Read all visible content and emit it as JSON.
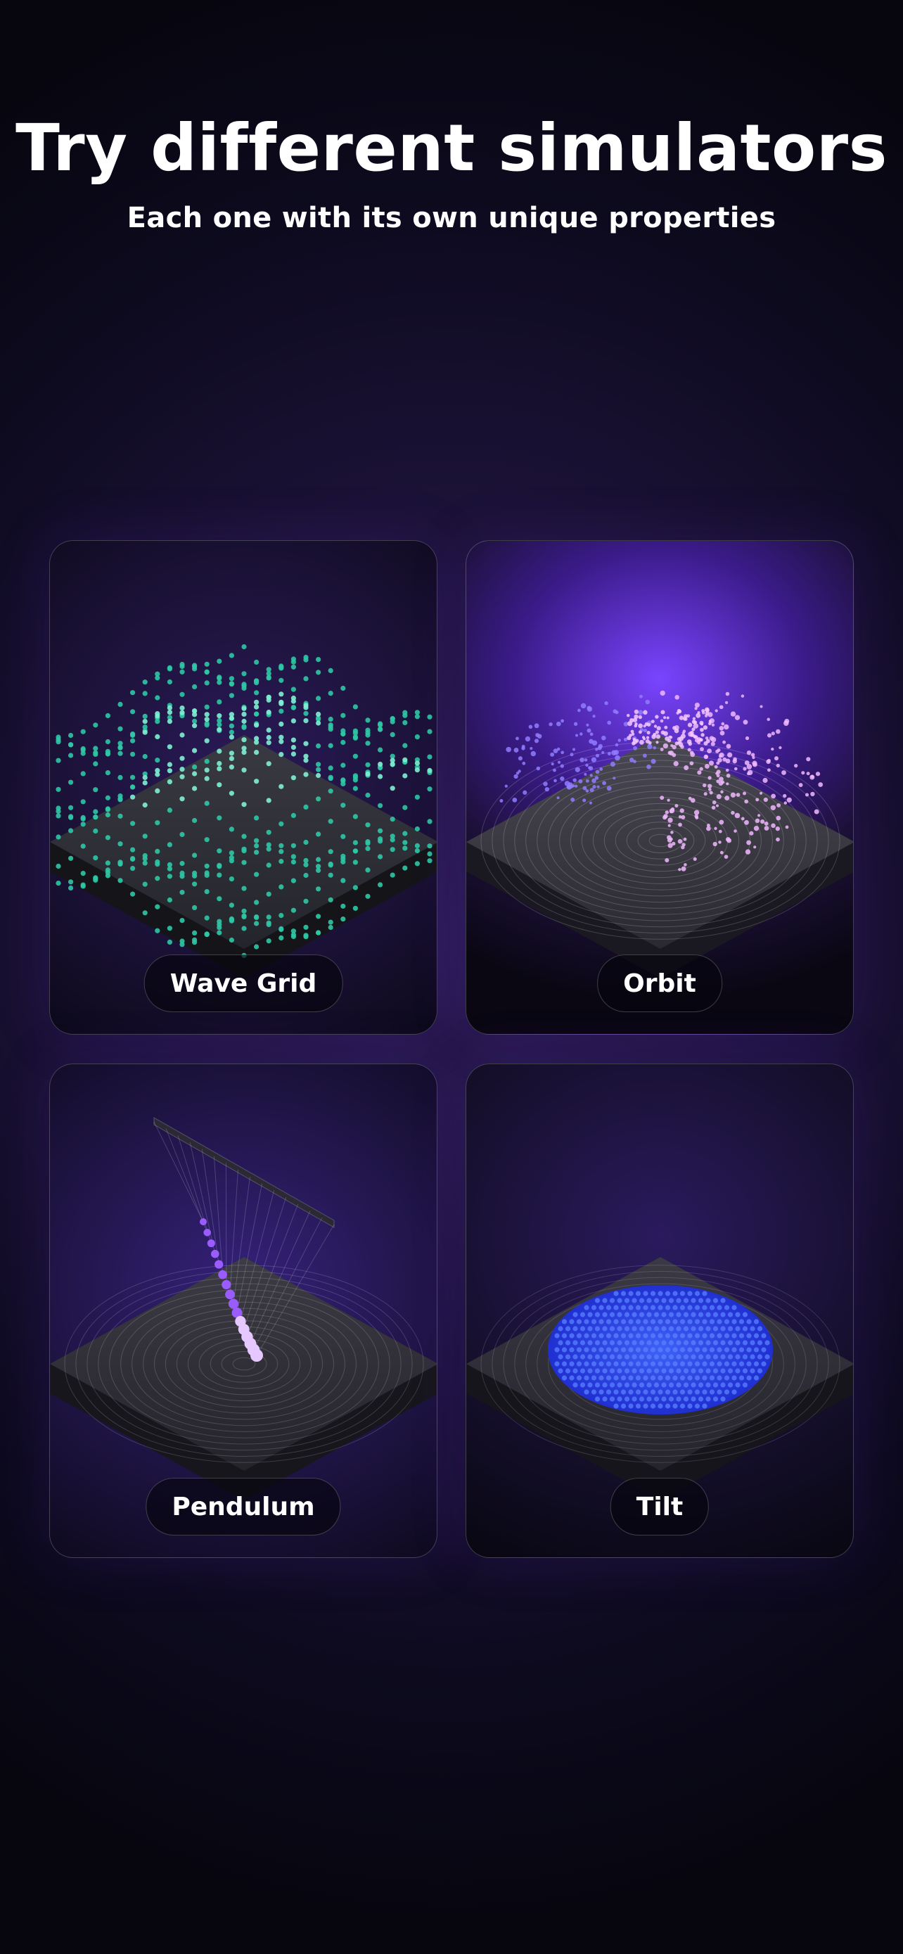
{
  "hero": {
    "title": "Try different simulators",
    "subtitle": "Each one with its own unique properties"
  },
  "simulators": [
    {
      "key": "wave",
      "label": "Wave Grid",
      "accent": "#36d6b8"
    },
    {
      "key": "orbit",
      "label": "Orbit",
      "accent": "#d8a8ff"
    },
    {
      "key": "pend",
      "label": "Pendulum",
      "accent": "#b07bff"
    },
    {
      "key": "tilt",
      "label": "Tilt",
      "accent": "#2e4bff"
    }
  ]
}
